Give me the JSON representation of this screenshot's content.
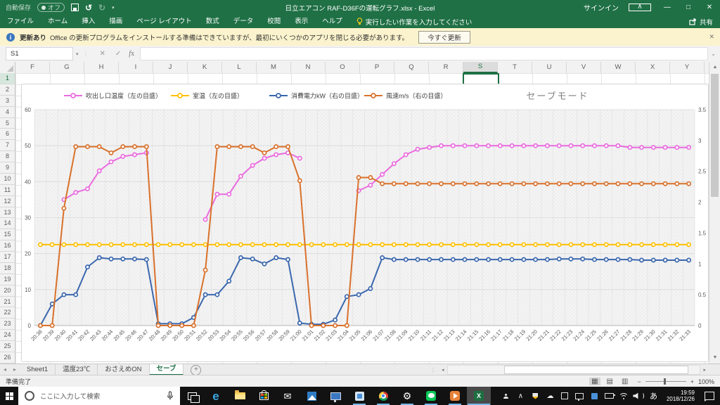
{
  "titlebar": {
    "autosave_label": "自動保存",
    "autosave_state": "オフ",
    "title": "日立エアコン RAF-D36Fの運転グラフ.xlsx  -  Excel",
    "signin": "サインイン",
    "minimize": "—",
    "restore": "□",
    "close": "✕"
  },
  "ribbon": {
    "tabs": [
      "ファイル",
      "ホーム",
      "挿入",
      "描画",
      "ページ レイアウト",
      "数式",
      "データ",
      "校閲",
      "表示",
      "ヘルプ"
    ],
    "tell_me": "実行したい作業を入力してください",
    "share": "共有"
  },
  "notification": {
    "title": "更新あり",
    "message": "Office の更新プログラムをインストールする準備はできていますが、最初にいくつかのアプリを閉じる必要があります。",
    "action": "今すぐ更新",
    "close": "✕"
  },
  "formula_bar": {
    "name_box": "S1",
    "fx": "fx"
  },
  "grid": {
    "columns": [
      "F",
      "G",
      "H",
      "I",
      "J",
      "K",
      "L",
      "M",
      "N",
      "O",
      "P",
      "Q",
      "R",
      "S",
      "T",
      "U",
      "V",
      "W",
      "X",
      "Y"
    ],
    "selected_column": "S",
    "selected_cell": "S1",
    "row_count": 26
  },
  "chart_data": {
    "type": "line",
    "title": "セーブモード",
    "legend_position": "top",
    "grid": true,
    "left_axis": {
      "min": 0,
      "max": 60,
      "step": 10
    },
    "right_axis": {
      "min": 0,
      "max": 3.5,
      "step": 0.5
    },
    "x": [
      "20:38",
      "20:39",
      "20:40",
      "20:41",
      "20:42",
      "20:43",
      "20:44",
      "20:45",
      "20:46",
      "20:47",
      "20:48",
      "20:49",
      "20:50",
      "20:51",
      "20:52",
      "20:53",
      "20:54",
      "20:55",
      "20:56",
      "20:57",
      "20:58",
      "20:59",
      "21:00",
      "21:01",
      "21:02",
      "21:03",
      "21:04",
      "21:05",
      "21:06",
      "21:07",
      "21:08",
      "21:09",
      "21:10",
      "21:11",
      "21:12",
      "21:13",
      "21:14",
      "21:15",
      "21:16",
      "21:17",
      "21:18",
      "21:19",
      "21:20",
      "21:21",
      "21:22",
      "21:23",
      "21:24",
      "21:25",
      "21:26",
      "21:27",
      "21:28",
      "21:29",
      "21:30",
      "21:31",
      "21:32",
      "21:33"
    ],
    "series": [
      {
        "name": "吹出し口温度（左の目盛）",
        "axis": "left",
        "color": "#EA6BDF",
        "values": [
          null,
          null,
          35,
          37,
          38,
          43,
          45.5,
          47,
          47.5,
          48,
          null,
          null,
          null,
          null,
          29.5,
          36.5,
          36.5,
          41.5,
          44.5,
          46.5,
          47.5,
          48,
          46.5,
          null,
          null,
          null,
          null,
          37.5,
          39,
          42,
          45,
          47.5,
          49,
          49.5,
          50,
          50,
          50,
          50,
          50,
          50,
          50,
          50,
          50,
          50,
          50,
          50,
          50,
          50,
          50,
          50,
          49.5,
          49.5,
          49.5,
          49.5,
          49.5,
          49.5
        ]
      },
      {
        "name": "室温（左の目盛）",
        "axis": "left",
        "color": "#FFC000",
        "values": [
          22.5,
          22.5,
          22.5,
          22.5,
          22.5,
          22.5,
          22.5,
          22.5,
          22.5,
          22.5,
          22.5,
          22.5,
          22.5,
          22.5,
          22.5,
          22.5,
          22.5,
          22.5,
          22.5,
          22.5,
          22.5,
          22.5,
          22.5,
          22.5,
          22.5,
          22.5,
          22.5,
          22.5,
          22.5,
          22.5,
          22.5,
          22.5,
          22.5,
          22.5,
          22.5,
          22.5,
          22.5,
          22.5,
          22.5,
          22.5,
          22.5,
          22.5,
          22.5,
          22.5,
          22.5,
          22.5,
          22.5,
          22.5,
          22.5,
          22.5,
          22.5,
          22.5,
          22.5,
          22.5,
          22.5,
          22.5
        ]
      },
      {
        "name": "消費電力kW（右の目盛）",
        "axis": "right",
        "color": "#3A67AE",
        "values": [
          0,
          0.35,
          0.5,
          0.5,
          0.95,
          1.1,
          1.08,
          1.08,
          1.08,
          1.07,
          0.03,
          0.03,
          0.03,
          0.13,
          0.5,
          0.5,
          0.72,
          1.1,
          1.08,
          1.0,
          1.1,
          1.07,
          0.04,
          0.02,
          0.02,
          0.09,
          0.47,
          0.5,
          0.6,
          1.1,
          1.07,
          1.07,
          1.07,
          1.07,
          1.07,
          1.07,
          1.07,
          1.07,
          1.07,
          1.07,
          1.07,
          1.07,
          1.07,
          1.07,
          1.08,
          1.08,
          1.08,
          1.07,
          1.07,
          1.07,
          1.07,
          1.06,
          1.06,
          1.06,
          1.06,
          1.06
        ]
      },
      {
        "name": "風速m/s（右の目盛）",
        "axis": "right",
        "color": "#D9712B",
        "values": [
          0,
          0,
          1.9,
          2.9,
          2.9,
          2.9,
          2.8,
          2.9,
          2.9,
          2.9,
          0,
          0,
          0,
          0,
          0.9,
          2.9,
          2.9,
          2.9,
          2.9,
          2.8,
          2.9,
          2.9,
          2.35,
          0,
          0,
          0,
          0,
          2.4,
          2.4,
          2.3,
          2.3,
          2.3,
          2.3,
          2.3,
          2.3,
          2.3,
          2.3,
          2.3,
          2.3,
          2.3,
          2.3,
          2.3,
          2.3,
          2.3,
          2.3,
          2.3,
          2.3,
          2.3,
          2.3,
          2.3,
          2.3,
          2.3,
          2.3,
          2.3,
          2.3,
          2.3
        ]
      }
    ]
  },
  "sheet_tabs": {
    "tabs": [
      "Sheet1",
      "温度23℃",
      "おさえめON",
      "セーブ"
    ],
    "active": "セーブ",
    "add": "+"
  },
  "status_bar": {
    "ready": "準備完了",
    "zoom": "100%"
  },
  "taskbar": {
    "search_placeholder": "ここに入力して検索",
    "pinned_icons": [
      "task-view",
      "edge",
      "file-explorer",
      "store",
      "mail",
      "photos",
      "pc",
      "app",
      "chrome",
      "settings",
      "line",
      "video-app",
      "excel"
    ],
    "tray_icons": [
      "people",
      "chevron-up",
      "defender-shield",
      "cloud",
      "window",
      "display",
      "blue-app",
      "battery",
      "wifi",
      "volume"
    ],
    "ime": "あ",
    "time": "19:59",
    "date": "2018/12/26"
  }
}
